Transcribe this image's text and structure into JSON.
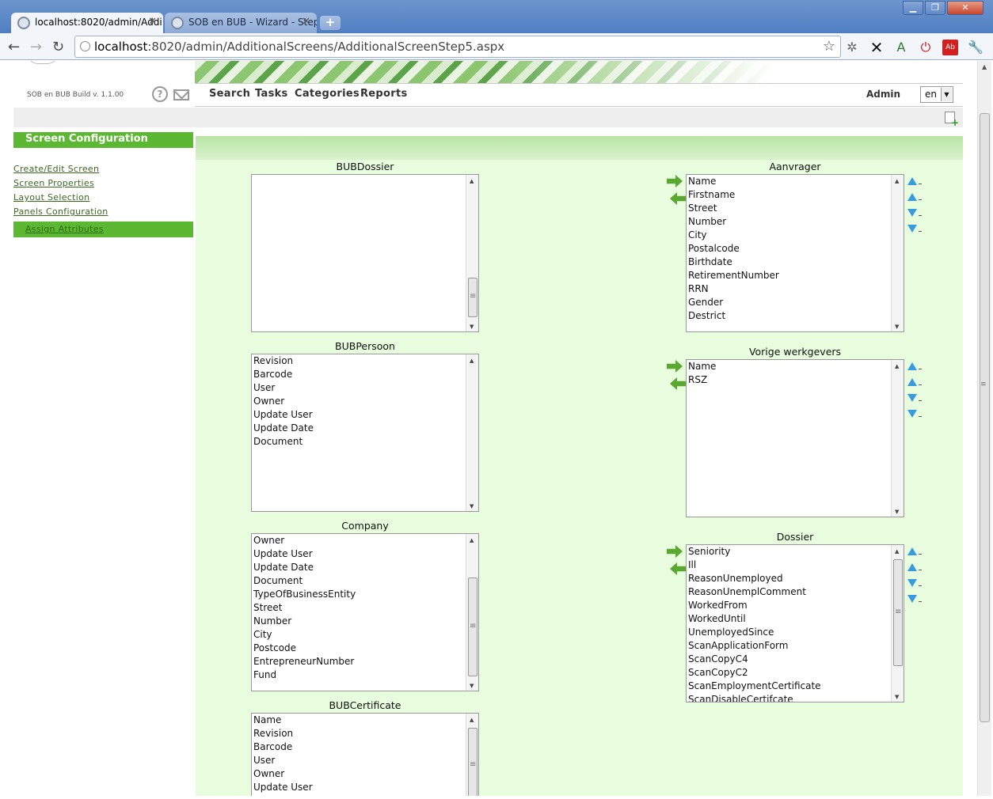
{
  "browser": {
    "tabs": [
      {
        "label": "localhost:8020/admin/Addi"
      },
      {
        "label": "SOB en BUB - Wizard - Step"
      }
    ],
    "url_host": "localhost",
    "url_rest": ":8020/admin/AdditionalScreens/AdditionalScreenStep5.aspx"
  },
  "header": {
    "build": "SOB en BUB Build v. 1.1.00",
    "nav": [
      "Search",
      "Tasks",
      "Categories",
      "Reports"
    ],
    "user": "Admin",
    "language": "en"
  },
  "sidebar": {
    "title": "Screen Configuration",
    "links": [
      "Create/Edit Screen",
      "Screen Properties",
      "Layout Selection",
      "Panels Configuration"
    ],
    "active": "Assign Attributes"
  },
  "source_lists": [
    {
      "title": "BUBDossier",
      "items": []
    },
    {
      "title": "BUBPersoon",
      "items": [
        "Revision",
        "Barcode",
        "User",
        "Owner",
        "Update User",
        "Update Date",
        "Document"
      ]
    },
    {
      "title": "Company",
      "items": [
        "Owner",
        "Update User",
        "Update Date",
        "Document",
        "TypeOfBusinessEntity",
        "Street",
        "Number",
        "City",
        "Postcode",
        "EntrepreneurNumber",
        "Fund"
      ]
    },
    {
      "title": "BUBCertificate",
      "items": [
        "Name",
        "Revision",
        "Barcode",
        "User",
        "Owner",
        "Update User"
      ]
    }
  ],
  "target_lists": [
    {
      "title": "Aanvrager",
      "items": [
        "Name",
        "Firstname",
        "Street",
        "Number",
        "City",
        "Postalcode",
        "Birthdate",
        "RetirementNumber",
        "RRN",
        "Gender",
        "Destrict"
      ]
    },
    {
      "title": "Vorige werkgevers",
      "items": [
        "Name",
        "RSZ"
      ]
    },
    {
      "title": "Dossier",
      "items": [
        "Seniority",
        "Ill",
        "ReasonUnemployed",
        "ReasonUnemplComment",
        "WorkedFrom",
        "WorkedUntil",
        "UnemployedSince",
        "ScanApplicationForm",
        "ScanCopyC4",
        "ScanCopyC2",
        "ScanEmploymentCertificate",
        "ScanDisableCertifcate"
      ]
    }
  ],
  "colors": {
    "accent": "#5cb832",
    "content_bg": "#e8fcde",
    "order_arrows": "#3a9ae0"
  }
}
